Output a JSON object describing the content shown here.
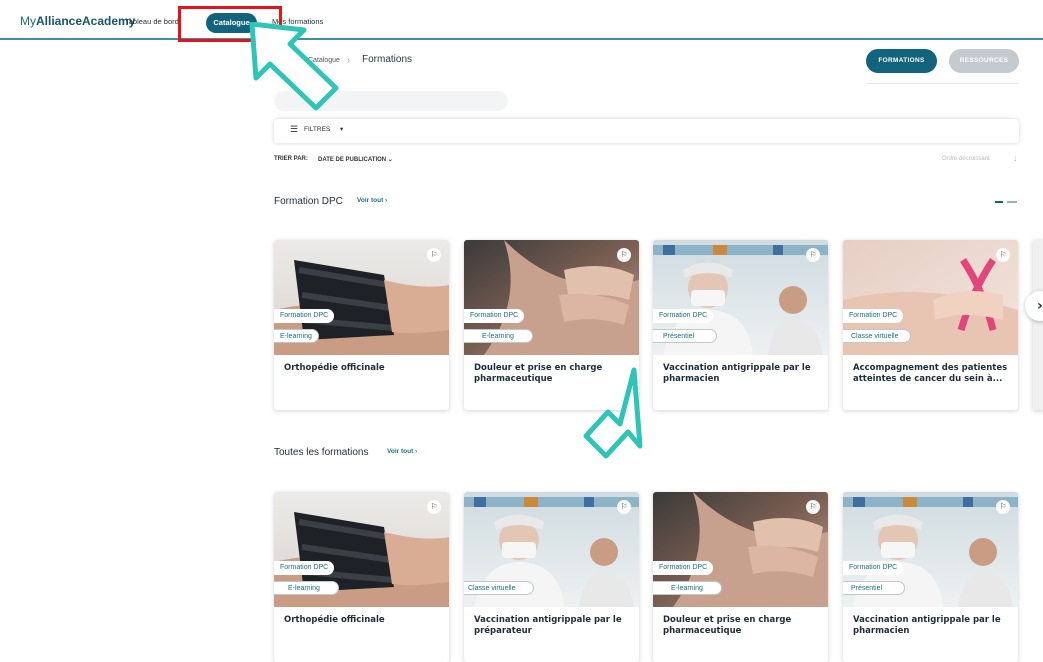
{
  "header": {
    "brand_prefix": "My",
    "brand_bold": "AllianceAcademy",
    "nav": {
      "dashboard": "Tableau de bord",
      "catalogue": "Catalogue",
      "my_formations": "Mes formations"
    }
  },
  "breadcrumb": {
    "parent": "Catalogue",
    "separator": "›",
    "current": "Formations"
  },
  "toggles": {
    "formations": "FORMATIONS",
    "ressources": "RESSOURCES"
  },
  "filters": {
    "label": "FILTRES",
    "chevron": "▾"
  },
  "sort": {
    "label": "TRIER PAR:",
    "value": "DATE DE PUBLICATION",
    "order": "Ordre décroissant"
  },
  "sections": [
    {
      "title": "Formation DPC",
      "see_all": "Voir tout",
      "cards": [
        {
          "tag1": "Formation DPC",
          "tag2": "E-learning",
          "title": "Orthopédie officinale",
          "image": "wrist-brace"
        },
        {
          "tag1": "Formation DPC",
          "tag2": "E-learning",
          "title": "Douleur et prise en charge pharmaceutique",
          "image": "neck-pain"
        },
        {
          "tag1": "Formation DPC",
          "tag2": "Présentiel",
          "title": "Vaccination antigrippale par le pharmacien",
          "image": "pharmacist-masked"
        },
        {
          "tag1": "Formation DPC",
          "tag2": "Classe virtuelle",
          "title": "Accompagnement des patientes atteintes de cancer du sein à...",
          "image": "pink-ribbon"
        }
      ]
    },
    {
      "title": "Toutes les formations",
      "see_all": "Voir tout",
      "cards": [
        {
          "tag1": "Formation DPC",
          "tag2": "E-learning",
          "title": "Orthopédie officinale",
          "image": "wrist-brace"
        },
        {
          "tag1": "",
          "tag2": "Classe virtuelle",
          "title": "Vaccination antigrippale par le préparateur",
          "image": "pharmacist-masked"
        },
        {
          "tag1": "Formation DPC",
          "tag2": "E-learning",
          "title": "Douleur et prise en charge pharmaceutique",
          "image": "neck-pain"
        },
        {
          "tag1": "Formation DPC",
          "tag2": "Présentiel",
          "title": "Vaccination antigrippale par le pharmacien",
          "image": "pharmacist-masked"
        }
      ]
    }
  ],
  "colors": {
    "brand": "#12647d",
    "highlight_box": "#e5141b",
    "annotation_arrow": "#2ec4b6"
  },
  "icons": {
    "bookmark": "bookmark-icon",
    "filter": "sliders-icon",
    "sort_arrow": "arrow-down-icon",
    "next": "chevron-right-icon"
  }
}
